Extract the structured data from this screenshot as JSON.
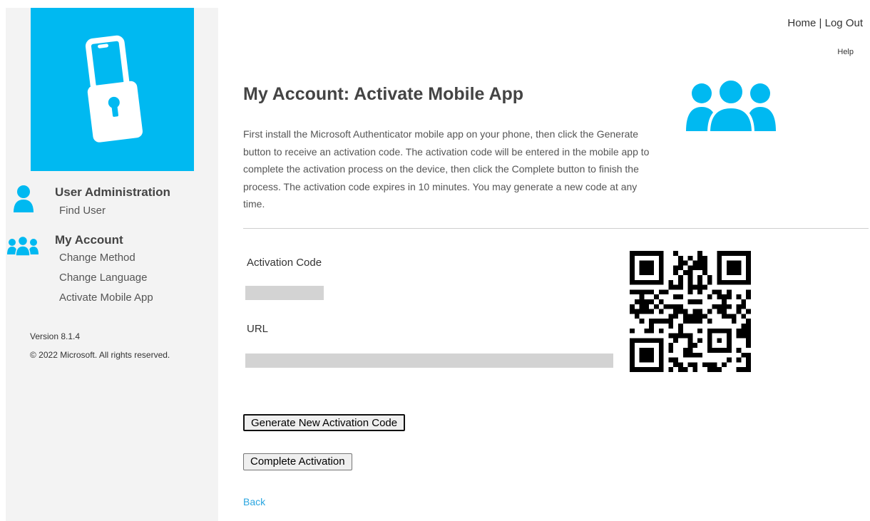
{
  "header": {
    "home_link": "Home",
    "separator": " | ",
    "logout_link": "Log Out",
    "help_link": "Help"
  },
  "sidebar": {
    "sections": [
      {
        "heading": "User Administration",
        "icon": "user-icon",
        "links": [
          "Find User"
        ]
      },
      {
        "heading": "My Account",
        "icon": "users-group-icon",
        "links": [
          "Change Method",
          "Change Language",
          "Activate Mobile App"
        ]
      }
    ],
    "version": "Version 8.1.4",
    "copyright": "© 2022 Microsoft. All rights reserved."
  },
  "main": {
    "title": "My Account: Activate Mobile App",
    "intro": "First install the Microsoft Authenticator mobile app on your phone, then click the Generate button to receive an activation code. The activation code will be entered in the mobile app to complete the activation process on the device, then click the Complete button to finish the process. The activation code expires in 10 minutes. You may generate a new code at any time.",
    "activation_code_label": "Activation Code",
    "url_label": "URL",
    "generate_button": "Generate New Activation Code",
    "complete_button": "Complete Activation",
    "back_link": "Back"
  },
  "colors": {
    "brand": "#00b9f1",
    "link": "#2ba6e0"
  }
}
